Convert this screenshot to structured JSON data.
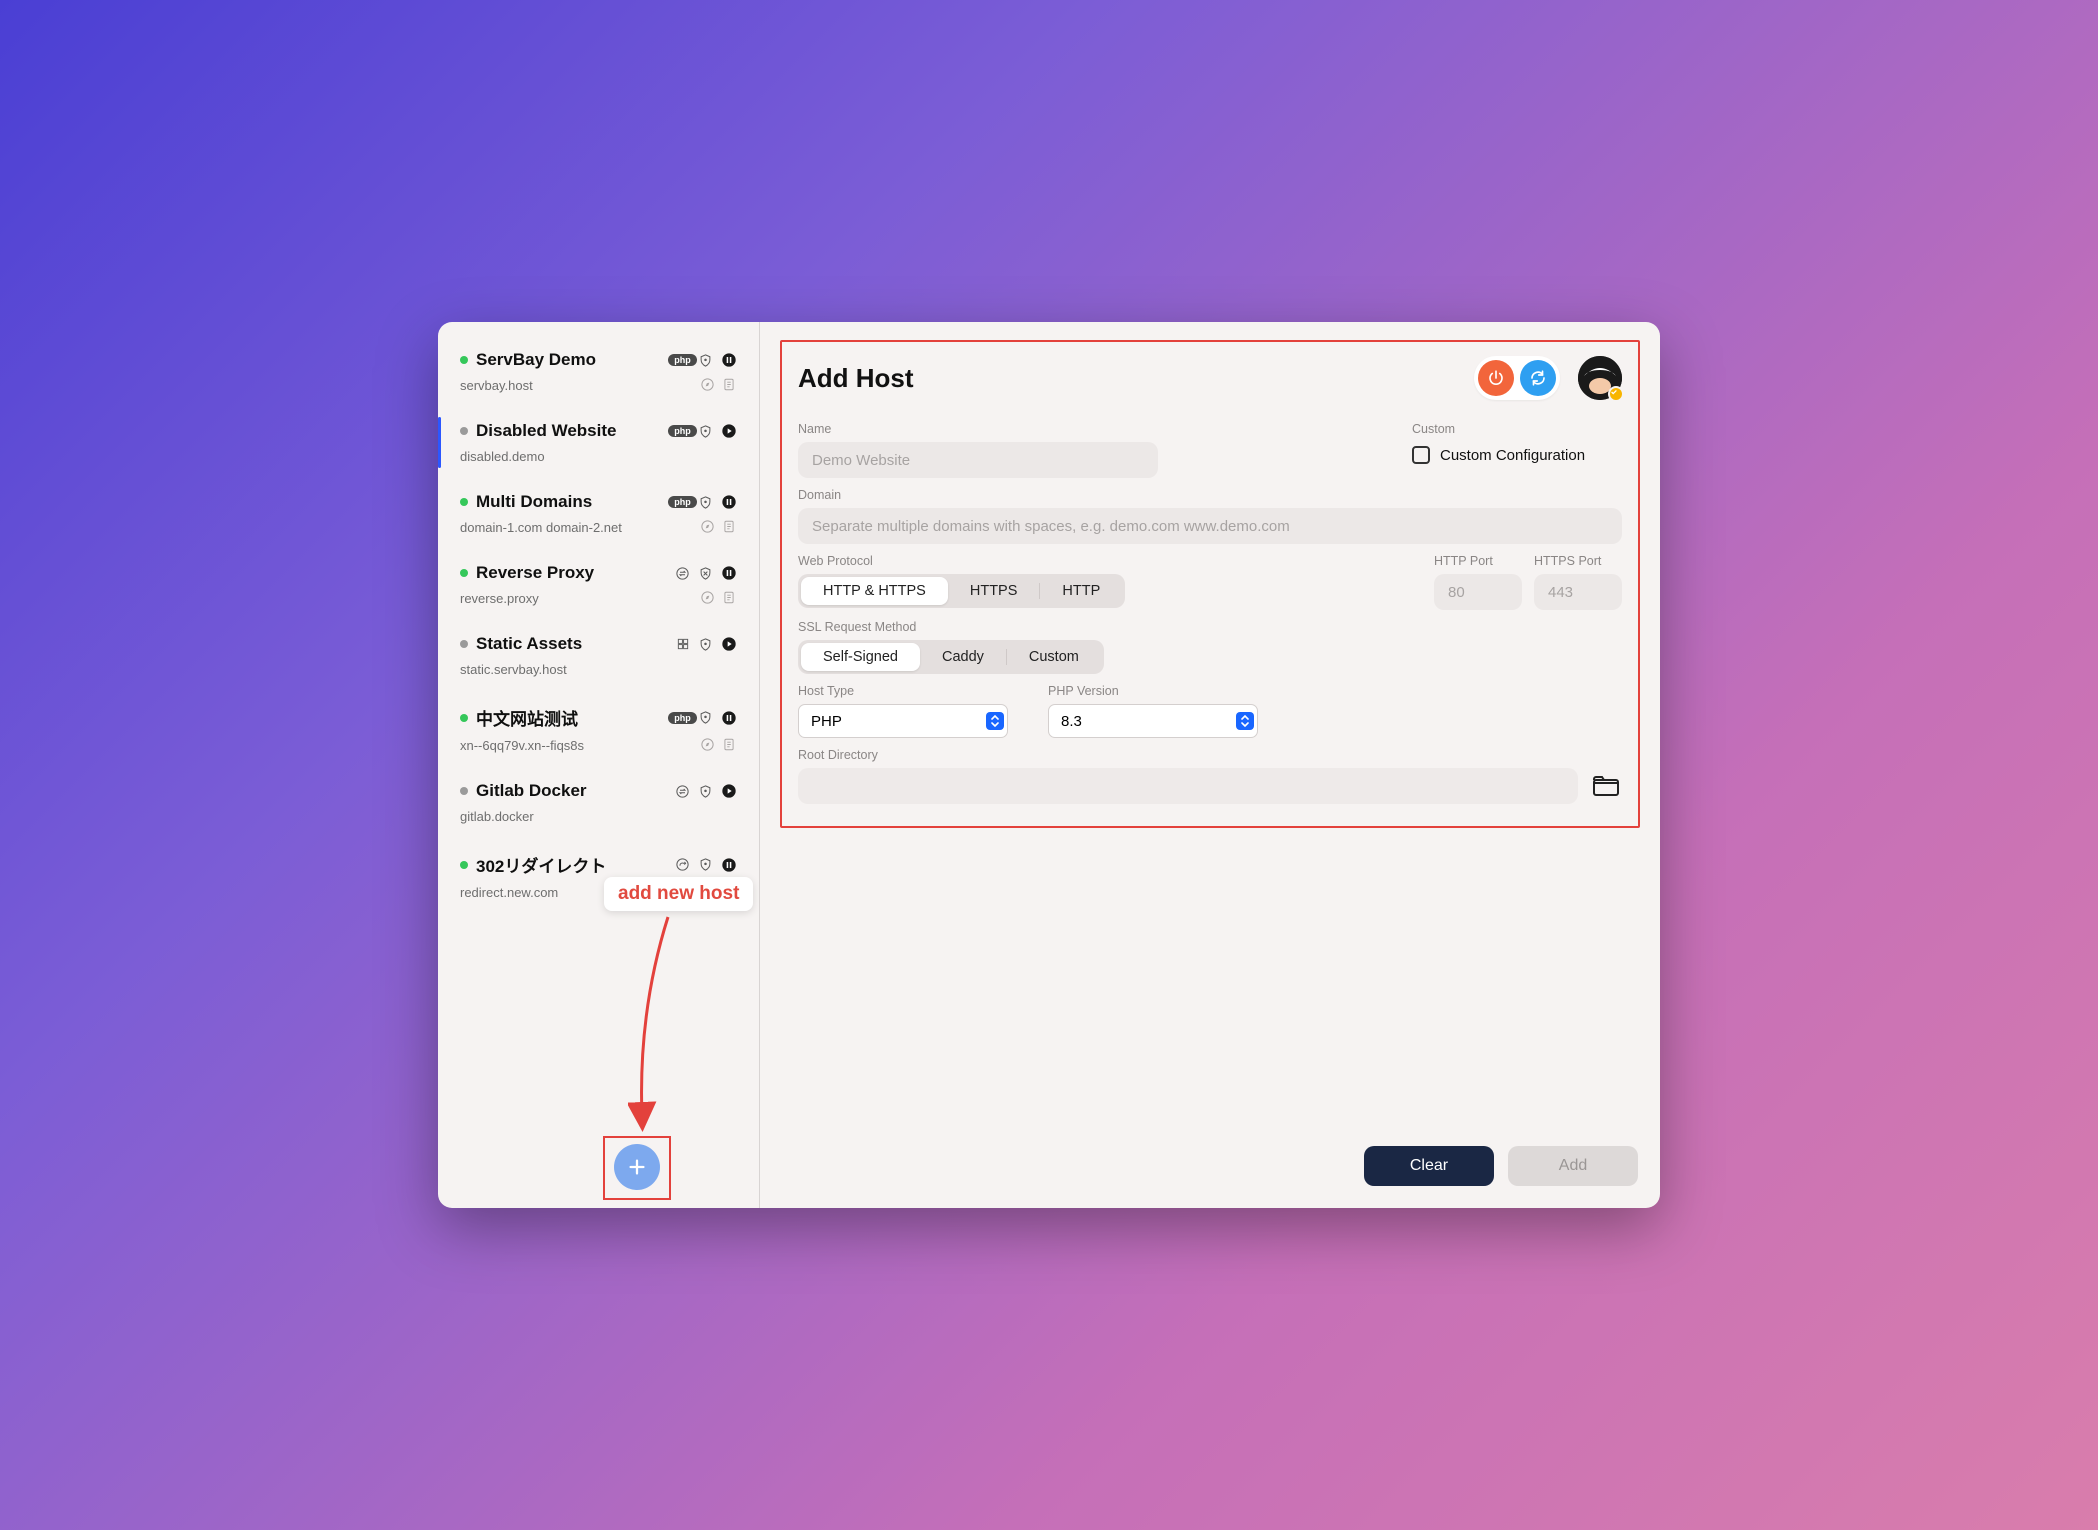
{
  "sidebar": {
    "items": [
      {
        "name": "ServBay Demo",
        "domain": "servbay.host",
        "status": "green",
        "icons": [
          "php",
          "shield",
          "pause"
        ],
        "sub": [
          "compass",
          "doc"
        ]
      },
      {
        "name": "Disabled Website",
        "domain": "disabled.demo",
        "status": "gray",
        "icons": [
          "php",
          "shield",
          "play"
        ],
        "sub": [],
        "selected": true
      },
      {
        "name": "Multi Domains",
        "domain": "domain-1.com domain-2.net",
        "status": "green",
        "icons": [
          "php",
          "shield",
          "pause"
        ],
        "sub": [
          "compass",
          "doc"
        ]
      },
      {
        "name": "Reverse Proxy",
        "domain": "reverse.proxy",
        "status": "green",
        "icons": [
          "swap",
          "shield-x",
          "pause"
        ],
        "sub": [
          "compass",
          "doc"
        ]
      },
      {
        "name": "Static Assets",
        "domain": "static.servbay.host",
        "status": "gray",
        "icons": [
          "grid",
          "shield",
          "play"
        ],
        "sub": []
      },
      {
        "name": "中文网站测试",
        "domain": "xn--6qq79v.xn--fiqs8s",
        "status": "green",
        "icons": [
          "php",
          "shield",
          "pause"
        ],
        "sub": [
          "compass",
          "doc"
        ]
      },
      {
        "name": "Gitlab Docker",
        "domain": "gitlab.docker",
        "status": "gray",
        "icons": [
          "swap",
          "shield",
          "play"
        ],
        "sub": []
      },
      {
        "name": "302リダイレクト",
        "domain": "redirect.new.com",
        "status": "green",
        "icons": [
          "redirect",
          "shield",
          "pause"
        ],
        "sub": [
          "compass",
          "doc"
        ]
      }
    ]
  },
  "annotation": {
    "callout": "add new host"
  },
  "header": {
    "title": "Add Host"
  },
  "form": {
    "name_label": "Name",
    "name_placeholder": "Demo Website",
    "custom_label": "Custom",
    "custom_checkbox_label": "Custom Configuration",
    "domain_label": "Domain",
    "domain_placeholder": "Separate multiple domains with spaces, e.g. demo.com www.demo.com",
    "protocol_label": "Web Protocol",
    "protocol_options": [
      "HTTP & HTTPS",
      "HTTPS",
      "HTTP"
    ],
    "protocol_selected": "HTTP & HTTPS",
    "http_port_label": "HTTP Port",
    "http_port_placeholder": "80",
    "https_port_label": "HTTPS Port",
    "https_port_placeholder": "443",
    "ssl_label": "SSL Request Method",
    "ssl_options": [
      "Self-Signed",
      "Caddy",
      "Custom"
    ],
    "ssl_selected": "Self-Signed",
    "host_type_label": "Host Type",
    "host_type_value": "PHP",
    "php_version_label": "PHP Version",
    "php_version_value": "8.3",
    "root_label": "Root Directory"
  },
  "footer": {
    "clear": "Clear",
    "add": "Add"
  }
}
